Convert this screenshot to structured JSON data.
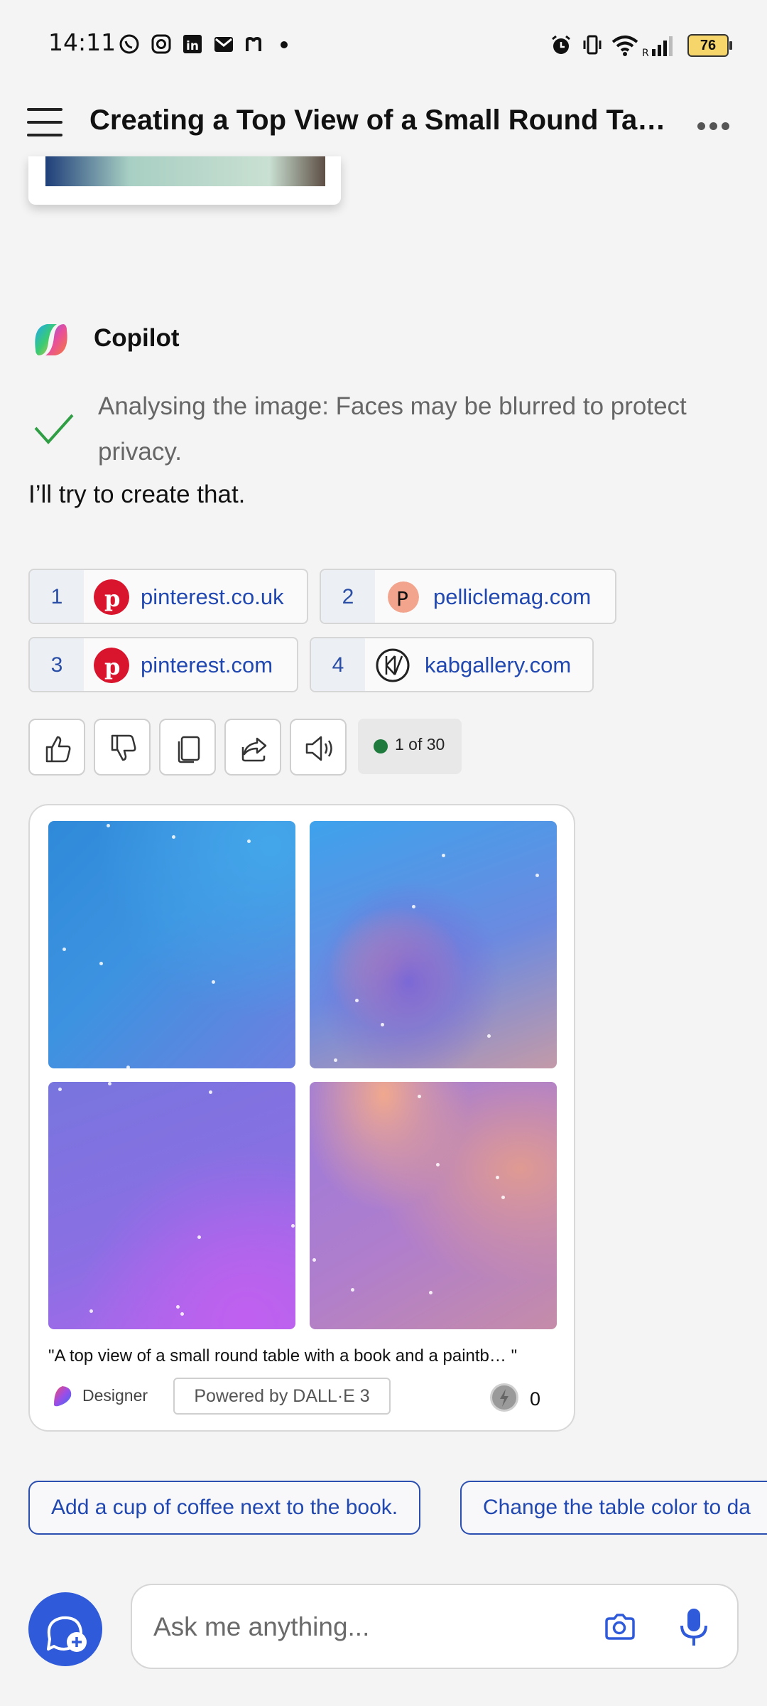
{
  "status_bar": {
    "time": "14:11",
    "battery": "76",
    "left_icons": [
      "whatsapp-icon",
      "instagram-icon",
      "linkedin-icon",
      "gmail-icon",
      "medium-icon",
      "dot-icon"
    ],
    "right_icons": [
      "alarm-icon",
      "vibrate-icon",
      "wifi-icon",
      "signal-icon",
      "battery-icon"
    ]
  },
  "header": {
    "title": "Creating a Top View of a Small Round Table with a Book and Paintbrush"
  },
  "message": {
    "sender": "Copilot",
    "status": "Analysing the image: Faces may be blurred to protect privacy.",
    "reply": "I’ll try to create that."
  },
  "sources": [
    {
      "num": "1",
      "domain": "pinterest.co.uk",
      "icon": "pinterest-icon"
    },
    {
      "num": "2",
      "domain": "pelliclemag.com",
      "icon": "pellicle-icon"
    },
    {
      "num": "3",
      "domain": "pinterest.com",
      "icon": "pinterest-icon"
    },
    {
      "num": "4",
      "domain": "kabgallery.com",
      "icon": "kabgallery-icon"
    }
  ],
  "actions": {
    "counter": "1 of 30",
    "counter_color": "#1e7a3d"
  },
  "image_card": {
    "prompt": "\"A top view of a small round table with a book and a paintb… \"",
    "brand": "Designer",
    "powered_by": "Powered by DALL·E 3",
    "boost_count": "0"
  },
  "suggestions": [
    "Add a cup of coffee next to the book.",
    "Change the table color to da"
  ],
  "input": {
    "placeholder": "Ask me anything..."
  },
  "colors": {
    "accent": "#2f5ad9",
    "link": "#2148b0",
    "background": "#f4f4f4"
  }
}
